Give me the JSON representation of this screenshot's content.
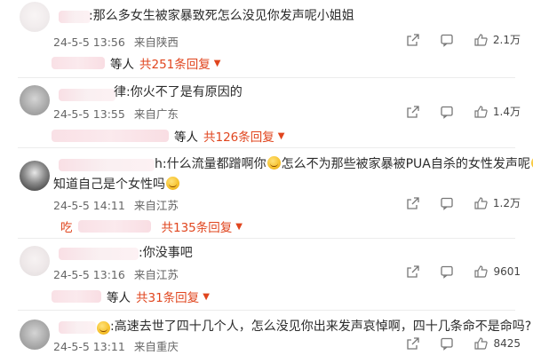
{
  "comments": [
    {
      "text": ":那么多女生被家暴致死怎么没见你发声呢小姐姐",
      "date": "24-5-5 13:56",
      "location": "来自陕西",
      "likes": "2.1万",
      "replies_who": "等人",
      "replies_count": "共251条回复"
    },
    {
      "text": "律:你火不了是有原因的",
      "date": "24-5-5 13:55",
      "location": "来自广东",
      "likes": "1.4万",
      "replies_who": "等人",
      "replies_count": "共126条回复"
    },
    {
      "text_a": "h:什么流量都蹭啊你",
      "text_b": "怎么不为那些被家暴被PUA自杀的女性发声呢",
      "text_c": "你",
      "text_line2": "知道自己是个女性吗",
      "date": "24-5-5 14:11",
      "location": "来自江苏",
      "likes": "1.2万",
      "replies_prefix": "吃",
      "replies_count": "共135条回复"
    },
    {
      "text": ":你没事吧",
      "date": "24-5-5 13:16",
      "location": "来自江苏",
      "likes": "9601",
      "replies_who": "等人",
      "replies_count": "共31条回复"
    },
    {
      "text": ":高速去世了四十几个人，怎么没见你出来发声哀悼啊，四十几条命不是命吗?",
      "date": "24-5-5 13:11",
      "location": "来自重庆",
      "likes": "8425"
    }
  ],
  "icons": {
    "share": "share-icon",
    "comment": "comment-icon",
    "like": "thumbs-up-icon",
    "emoji": "smile-emoji-icon"
  },
  "colors": {
    "accent": "#e0451e",
    "text": "#2b2b2b",
    "meta": "#666666"
  }
}
